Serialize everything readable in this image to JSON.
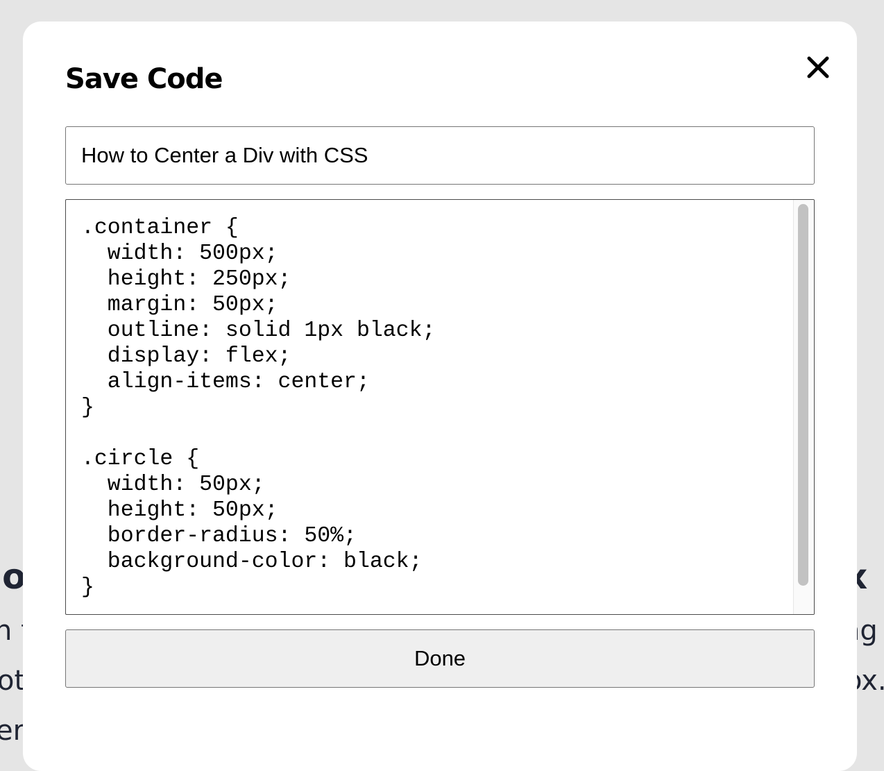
{
  "background_page": {
    "left_heading_fragment": "lo",
    "left_line1_fragment": "n t",
    "left_line2_fragment": "ot",
    "left_line3_fragment": "er",
    "right_heading_fragment": "x",
    "right_line1_fragment": "ng",
    "right_line2_fragment": "ox."
  },
  "modal": {
    "title": "Save Code",
    "close_icon": "close-icon",
    "title_input_value": "How to Center a Div with CSS",
    "code": ".container {\n  width: 500px;\n  height: 250px;\n  margin: 50px;\n  outline: solid 1px black;\n  display: flex;\n  align-items: center;\n}\n\n.circle {\n  width: 50px;\n  height: 50px;\n  border-radius: 50%;\n  background-color: black;\n}",
    "done_label": "Done"
  },
  "colors": {
    "overlay_background": "#e5e5e5",
    "modal_background": "#ffffff",
    "button_background": "#efefef",
    "text": "#000000",
    "background_page_text": "#1f2433"
  }
}
